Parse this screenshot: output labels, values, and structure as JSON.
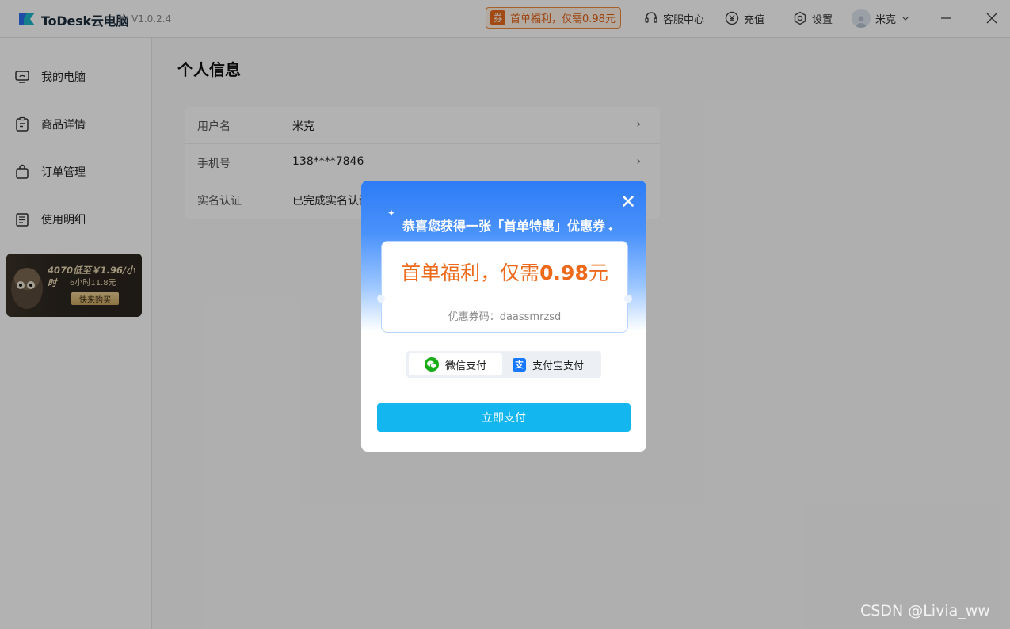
{
  "titlebar": {
    "brand": "ToDesk云电脑",
    "version": "V1.0.2.4",
    "promo_tag": "券",
    "promo_text": "首单福利，仅需0.98元",
    "service": "客服中心",
    "recharge": "充值",
    "settings": "设置",
    "username": "米克"
  },
  "sidebar": {
    "items": [
      {
        "label": "我的电脑",
        "icon": "computer-icon"
      },
      {
        "label": "商品详情",
        "icon": "clipboard-icon"
      },
      {
        "label": "订单管理",
        "icon": "bag-icon"
      },
      {
        "label": "使用明细",
        "icon": "list-icon"
      }
    ],
    "banner": {
      "line1": "4070低至￥1.96/小时",
      "line2": "6小时11.8元",
      "button": "快来购买"
    }
  },
  "main": {
    "title": "个人信息",
    "rows": [
      {
        "label": "用户名",
        "value": "米克"
      },
      {
        "label": "手机号",
        "value": "138****7846"
      },
      {
        "label": "实名认证",
        "value": "已完成实名认证"
      }
    ]
  },
  "modal": {
    "headline": "恭喜您获得一张「首单特惠」优惠券",
    "coupon_title_prefix": "首单福利，仅需",
    "coupon_title_price": "0.98",
    "coupon_title_suffix": "元",
    "coupon_code": "优惠券码：daassmrzsd",
    "pay_wechat": "微信支付",
    "pay_alipay": "支付宝支付",
    "pay_button": "立即支付"
  },
  "watermark": "CSDN @Livia_ww",
  "colors": {
    "accent": "#13b6ee",
    "promo": "#e25c10",
    "modal_blue": "#2d7cf6"
  }
}
